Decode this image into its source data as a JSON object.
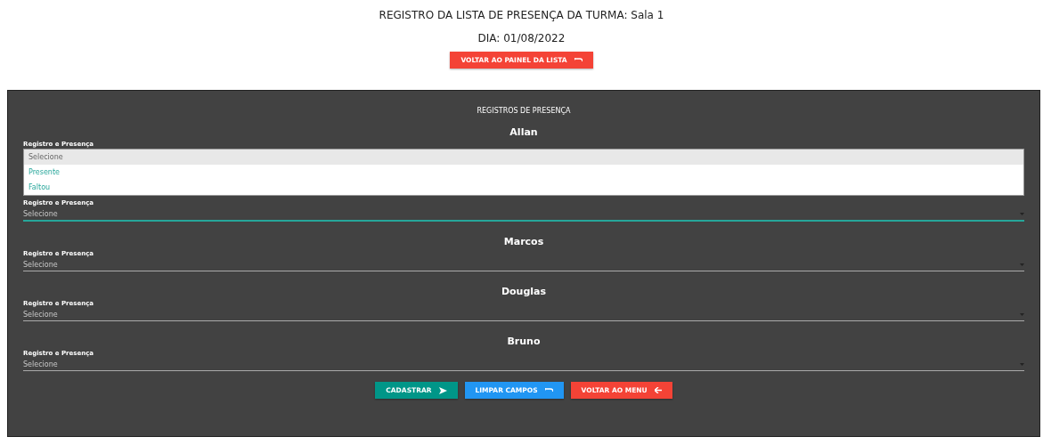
{
  "header": {
    "title": "REGISTRO DA LISTA DE PRESENÇA DA TURMA: Sala 1",
    "date": "DIA: 01/08/2022",
    "back_button": "VOLTAR AO PAINEL DA LISTA"
  },
  "panel": {
    "title": "REGISTROS DE PRESENÇA",
    "students": [
      {
        "name": "Allan",
        "label": "Registro e Presença",
        "value": "Selecione",
        "open": true,
        "menu_label": "Registro e Presença",
        "options": [
          {
            "label": "Selecione",
            "selected": true
          },
          {
            "label": "Presente",
            "selected": false
          },
          {
            "label": "Faltou",
            "selected": false
          }
        ]
      },
      {
        "name": "Marcos",
        "label": "Registro e Presença",
        "value": "Selecione",
        "open": false
      },
      {
        "name": "Douglas",
        "label": "Registro e Presença",
        "value": "Selecione",
        "open": false
      },
      {
        "name": "Bruno",
        "label": "Registro e Presença",
        "value": "Selecione",
        "open": false
      }
    ],
    "buttons": [
      {
        "kind": "submit",
        "label": "CADASTRAR"
      },
      {
        "kind": "clear",
        "label": "LIMPAR CAMPOS"
      },
      {
        "kind": "back",
        "label": "VOLTAR AO MENU"
      }
    ]
  }
}
